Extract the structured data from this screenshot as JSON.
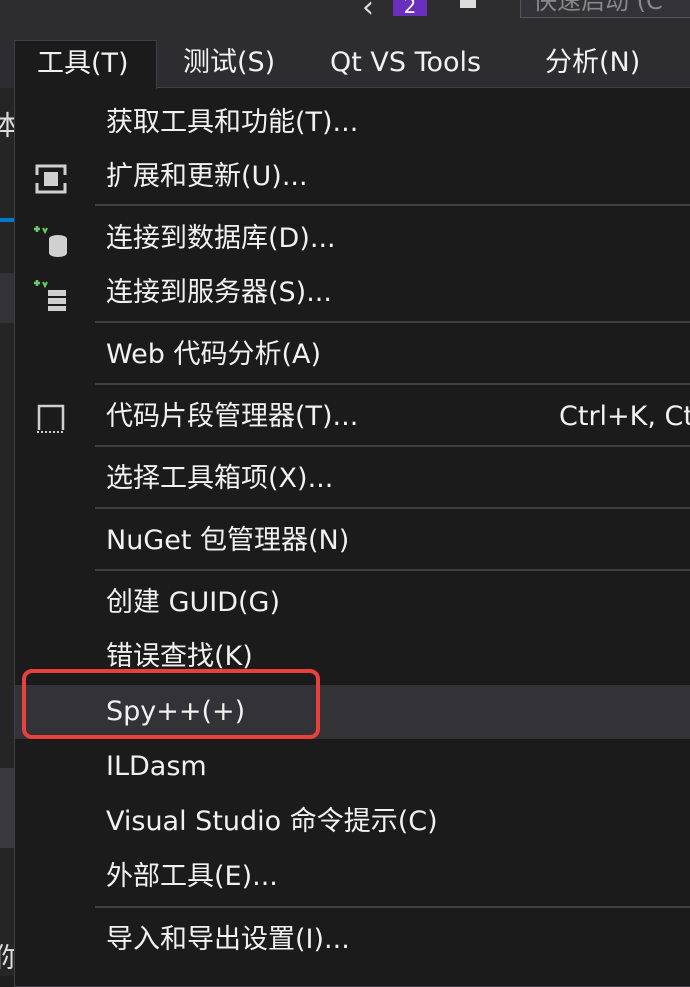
{
  "top": {
    "notification_count": "2",
    "search_placeholder": "快速启动 (C"
  },
  "menubar": [
    {
      "label": "工具(T)",
      "active": true
    },
    {
      "label": "测试(S)"
    },
    {
      "label": "Qt VS Tools"
    },
    {
      "label": "分析(N)"
    }
  ],
  "left_fragments": [
    "本",
    "你"
  ],
  "menu": {
    "items": [
      {
        "label": "获取工具和功能(T)..."
      },
      {
        "label": "扩展和更新(U)...",
        "icon": "extensions-icon"
      },
      {
        "label": "连接到数据库(D)...",
        "icon": "database-connect-icon"
      },
      {
        "label": "连接到服务器(S)...",
        "icon": "server-connect-icon"
      },
      {
        "label": "Web 代码分析(A)"
      },
      {
        "label": "代码片段管理器(T)...",
        "icon": "snippet-icon",
        "shortcut": "Ctrl+K, Ct"
      },
      {
        "label": "选择工具箱项(X)..."
      },
      {
        "label": "NuGet 包管理器(N)"
      },
      {
        "label": "创建 GUID(G)"
      },
      {
        "label": "错误查找(K)"
      },
      {
        "label": "Spy++(+)",
        "highlighted": true
      },
      {
        "label": "ILDasm"
      },
      {
        "label": "Visual Studio 命令提示(C)"
      },
      {
        "label": "外部工具(E)..."
      },
      {
        "label": "导入和导出设置(I)..."
      }
    ]
  },
  "colors": {
    "menu_bg": "#1b1b1c",
    "highlight_bg": "#333337",
    "callout": "#e8403c",
    "icon_green": "#6bcb6b"
  }
}
